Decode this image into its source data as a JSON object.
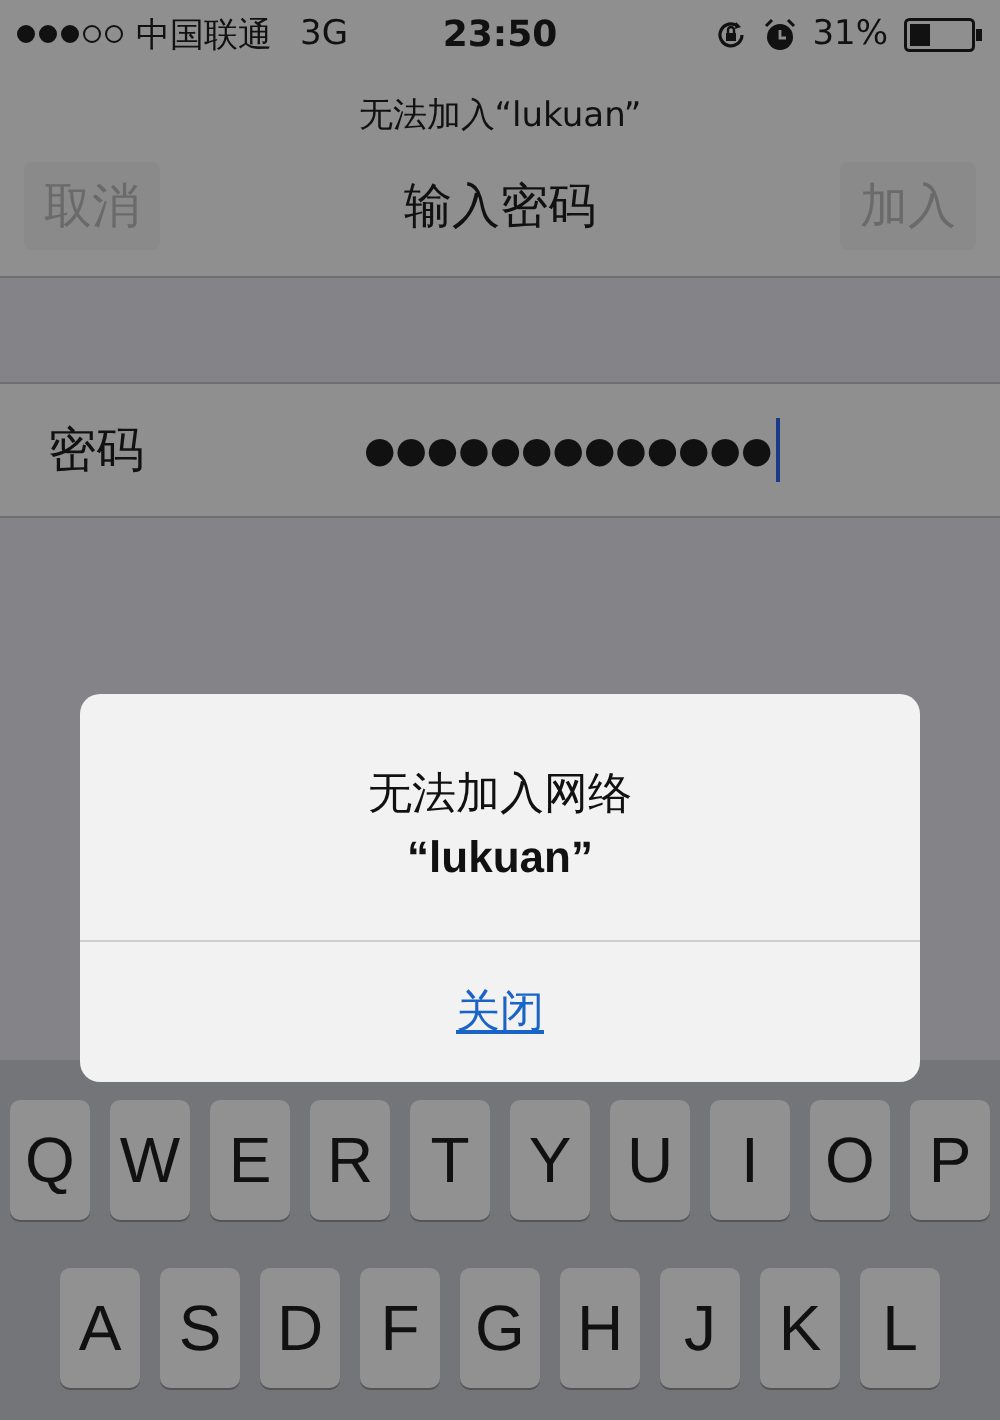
{
  "status_bar": {
    "carrier": "中国联通",
    "network": "3G",
    "time": "23:50",
    "battery": "31%"
  },
  "nav": {
    "subtitle": "无法加入“lukuan”",
    "title": "输入密码",
    "cancel": {
      "label": "取消",
      "disabled": true
    },
    "join": {
      "label": "加入",
      "disabled": true
    }
  },
  "password": {
    "label": "密码",
    "value": "●●●●●●●●●●●●●"
  },
  "alert": {
    "title": "无法加入网络",
    "name": "“lukuan”",
    "button": "关闭"
  },
  "keyboard": {
    "rows": [
      [
        "Q",
        "W",
        "E",
        "R",
        "T",
        "Y",
        "U",
        "I",
        "O",
        "P"
      ],
      [
        "A",
        "S",
        "D",
        "F",
        "G",
        "H",
        "J",
        "K",
        "L"
      ]
    ]
  }
}
